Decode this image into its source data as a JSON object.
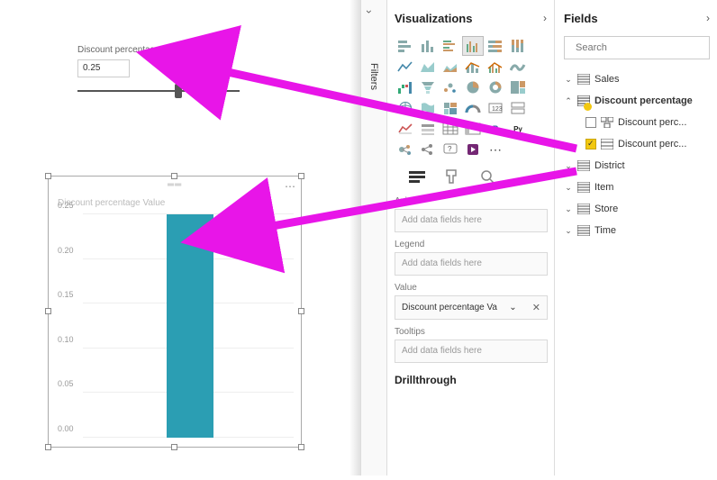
{
  "slicer": {
    "label": "Discount percentage",
    "value": "0.25"
  },
  "chart_data": {
    "type": "bar",
    "title": "Discount percentage Value",
    "categories": [
      ""
    ],
    "values": [
      0.25
    ],
    "ylabel": "",
    "xlabel": "",
    "ylim": [
      0,
      0.25
    ],
    "ticks": [
      0.0,
      0.05,
      0.1,
      0.15,
      0.2,
      0.25
    ]
  },
  "filters_rail": {
    "label": "Filters"
  },
  "vis_pane": {
    "title": "Visualizations",
    "sections": {
      "axis": "Axis",
      "legend": "Legend",
      "value": "Value",
      "tooltips": "Tooltips",
      "drill": "Drillthrough"
    },
    "placeholder": "Add data fields here",
    "value_field": "Discount percentage Va"
  },
  "fields_pane": {
    "title": "Fields",
    "search_placeholder": "Search",
    "tables": [
      {
        "name": "Sales",
        "expanded": false
      },
      {
        "name": "Discount percentage",
        "expanded": true,
        "highlighted": true,
        "children": [
          {
            "name": "Discount perc...",
            "checked": false,
            "icon": "hierarchy"
          },
          {
            "name": "Discount perc...",
            "checked": true,
            "icon": "table"
          }
        ]
      },
      {
        "name": "District",
        "expanded": false
      },
      {
        "name": "Item",
        "expanded": false
      },
      {
        "name": "Store",
        "expanded": false
      },
      {
        "name": "Time",
        "expanded": false
      }
    ]
  },
  "tick_labels": [
    "0.00",
    "0.05",
    "0.10",
    "0.15",
    "0.20",
    "0.25"
  ]
}
